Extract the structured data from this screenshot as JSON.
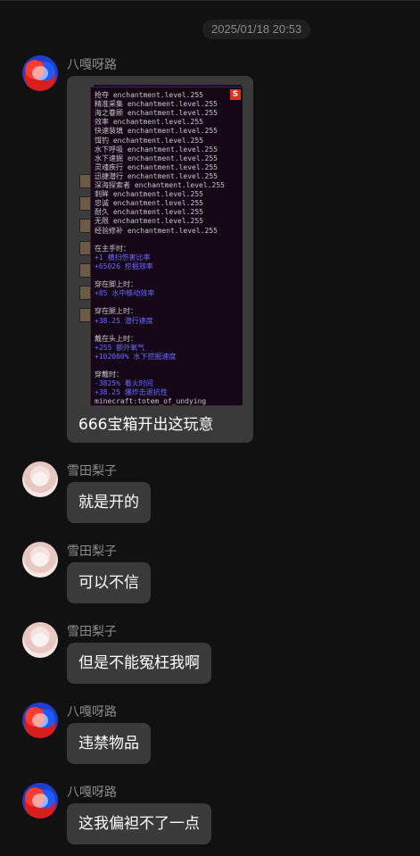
{
  "timestamp": "2025/01/18 20:53",
  "messages": [
    {
      "sender": "八嘎呀路",
      "image": {
        "badge": "S",
        "lines": [
          {
            "text": "抢夺 enchantment.level.255",
            "color": "gray"
          },
          {
            "text": "精准采集 enchantment.level.255",
            "color": "gray"
          },
          {
            "text": "海之眷顾 enchantment.level.255",
            "color": "gray"
          },
          {
            "text": "效率 enchantment.level.255",
            "color": "gray"
          },
          {
            "text": "快速装填 enchantment.level.255",
            "color": "gray"
          },
          {
            "text": "饵钓 enchantment.level.255",
            "color": "gray"
          },
          {
            "text": "水下呼吸 enchantment.level.255",
            "color": "gray"
          },
          {
            "text": "水下速掘 enchantment.level.255",
            "color": "gray"
          },
          {
            "text": "灵魂疾行 enchantment.level.255",
            "color": "gray"
          },
          {
            "text": "迅捷潜行 enchantment.level.255",
            "color": "gray"
          },
          {
            "text": "深海探索者 enchantment.level.255",
            "color": "gray"
          },
          {
            "text": "刺眸 enchantment.level.255",
            "color": "gray"
          },
          {
            "text": "忠诚 enchantment.level.255",
            "color": "gray"
          },
          {
            "text": "耐久 enchantment.level.255",
            "color": "gray"
          },
          {
            "text": "无限 enchantment.level.255",
            "color": "gray"
          },
          {
            "text": "经验修补 enchantment.level.255",
            "color": "gray"
          },
          {
            "text": "",
            "color": "gray"
          },
          {
            "text": "在主手时：",
            "color": "gray"
          },
          {
            "text": "+1 横扫伤害比率",
            "color": "blue"
          },
          {
            "text": "+65026 挖掘效率",
            "color": "blue"
          },
          {
            "text": "",
            "color": "gray"
          },
          {
            "text": "穿在脚上时：",
            "color": "gray"
          },
          {
            "text": "+85 水中移动效率",
            "color": "blue"
          },
          {
            "text": "",
            "color": "gray"
          },
          {
            "text": "穿在腿上时：",
            "color": "gray"
          },
          {
            "text": "+38.25 潜行速度",
            "color": "blue"
          },
          {
            "text": "",
            "color": "gray"
          },
          {
            "text": "戴在头上时：",
            "color": "gray"
          },
          {
            "text": "+255 额外氧气",
            "color": "blue"
          },
          {
            "text": "+102000% 水下挖掘速度",
            "color": "blue"
          },
          {
            "text": "",
            "color": "gray"
          },
          {
            "text": "穿戴时：",
            "color": "gray"
          },
          {
            "text": "-3825% 着火时间",
            "color": "blue"
          },
          {
            "text": "+38.25 爆炸击退抗性",
            "color": "blue"
          },
          {
            "text": "minecraft:totem_of_undying",
            "color": "gray"
          }
        ]
      },
      "text": "666宝箱开出这玩意"
    },
    {
      "sender": "雪田梨子",
      "text": "就是开的"
    },
    {
      "sender": "雪田梨子",
      "text": "可以不信"
    },
    {
      "sender": "雪田梨子",
      "text": "但是不能冤枉我啊"
    },
    {
      "sender": "八嘎呀路",
      "text": "违禁物品"
    },
    {
      "sender": "八嘎呀路",
      "text": "这我偏袒不了一点"
    }
  ]
}
